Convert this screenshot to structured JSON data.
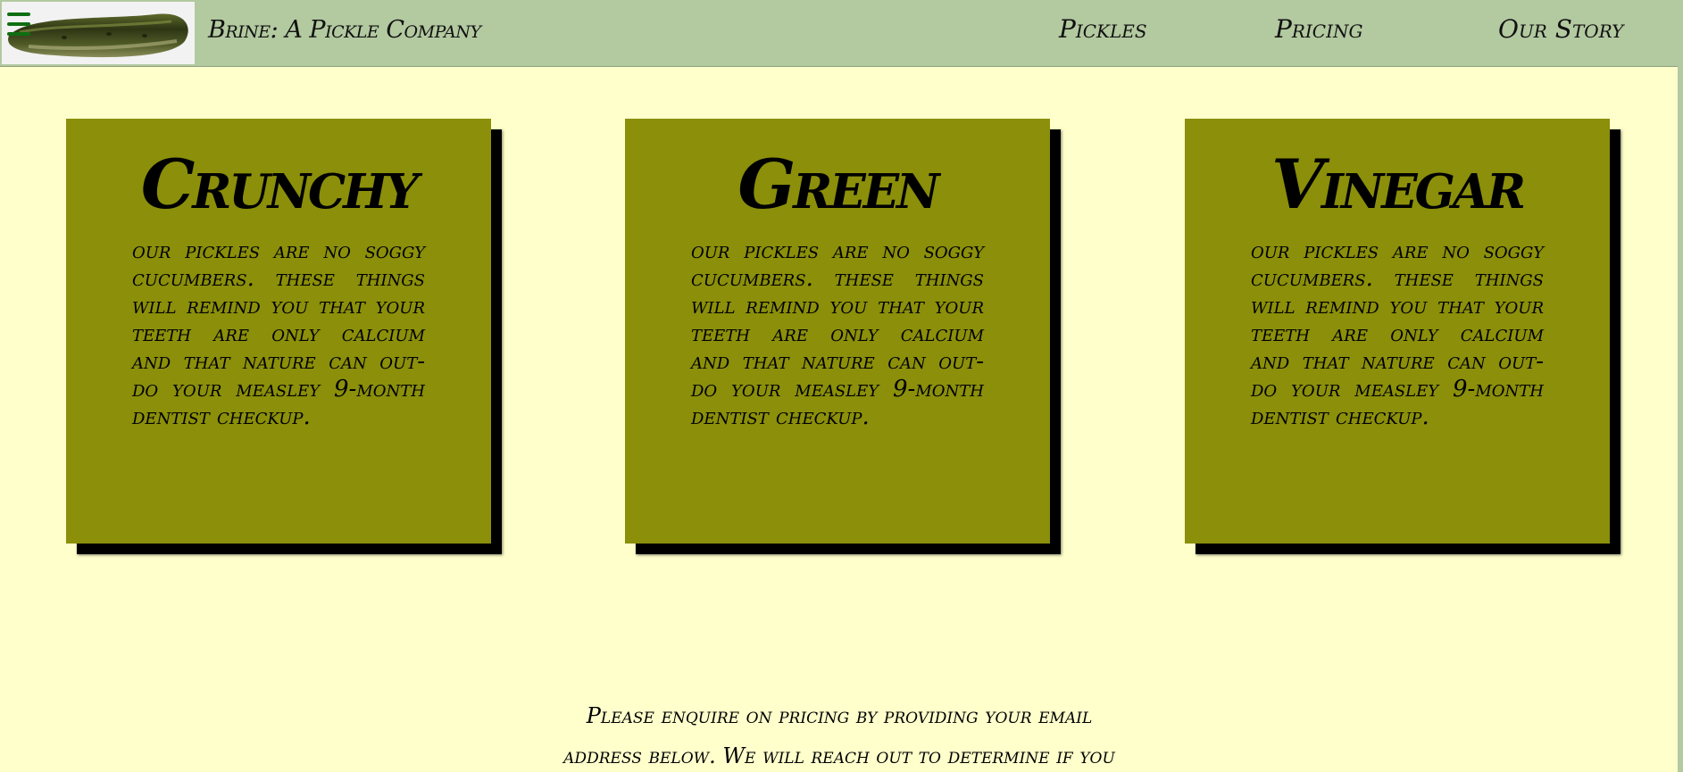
{
  "header": {
    "brand": "Brine: A Pickle Company",
    "nav": [
      {
        "label": "Pickles"
      },
      {
        "label": "Pricing"
      },
      {
        "label": "Our Story"
      }
    ]
  },
  "cards": [
    {
      "title": "Crunchy",
      "body": "Our pickles are no soggy cucumbers. These things will remind you that your teeth are only calcium and that nature can out-do your measley 9-month dentist checkup."
    },
    {
      "title": "Green",
      "body": "Our pickles are no soggy cucumbers. These things will remind you that your teeth are only calcium and that nature can out-do your measley 9-month dentist checkup."
    },
    {
      "title": "Vinegar",
      "body": "Our pickles are no soggy cucumbers. These things will remind you that your teeth are only calcium and that nature can out-do your measley 9-month dentist checkup."
    }
  ],
  "pricing": {
    "text": "Please enquire on pricing by providing your email address below. We will reach out to determine if you"
  },
  "icons": {
    "menu": "hamburger-menu-icon",
    "logo": "pickle-logo-image"
  },
  "colors": {
    "header_bg": "#b3c9a0",
    "page_bg": "#ffffcc",
    "card_bg": "#8b8f0a",
    "menu_icon": "#0f6e12"
  }
}
